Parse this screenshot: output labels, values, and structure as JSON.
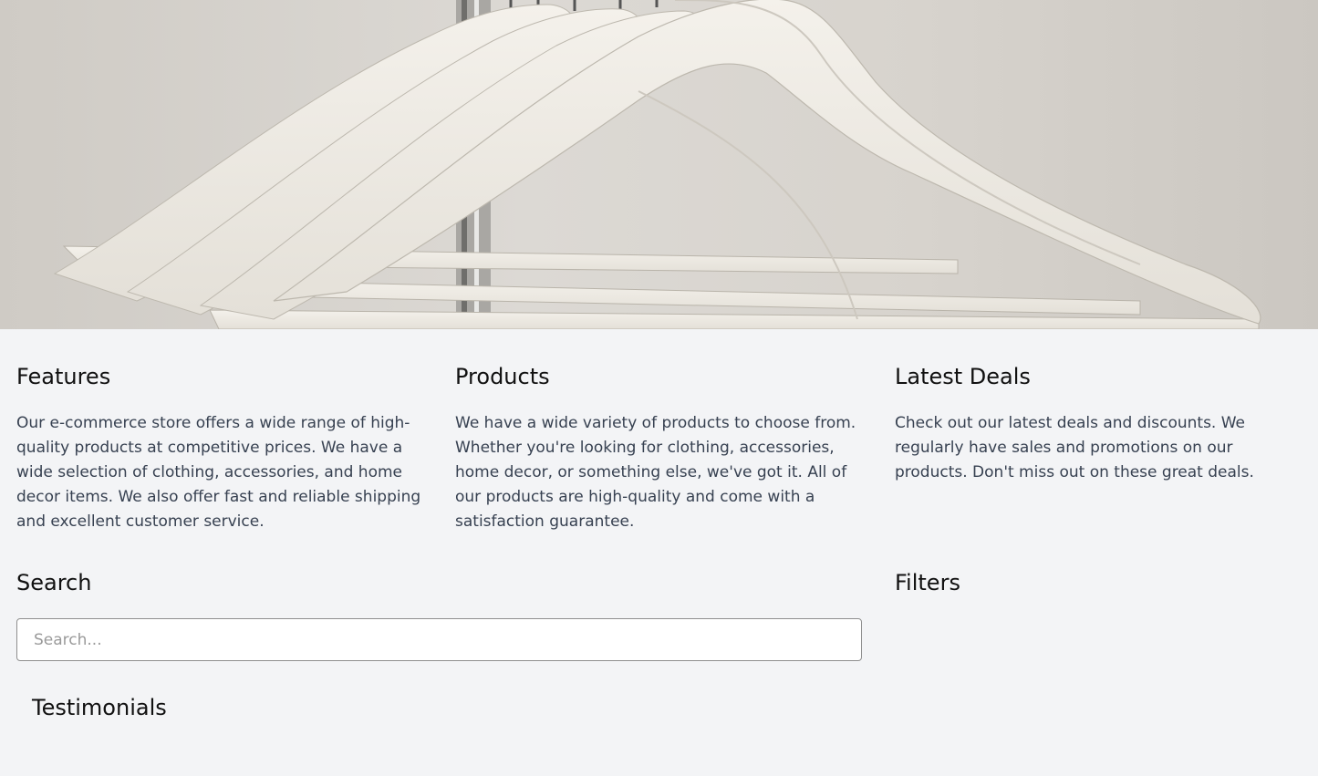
{
  "hero": {
    "image": "clothes-hangers-photo",
    "colors": {
      "background": "#d9d6d1",
      "hanger": "#f2efe9",
      "rail": "#8a8a8a"
    }
  },
  "features": {
    "title": "Features",
    "body": "Our e-commerce store offers a wide range of high-quality products at competitive prices. We have a wide selection of clothing, accessories, and home decor items. We also offer fast and reliable shipping and excellent customer service."
  },
  "products": {
    "title": "Products",
    "body": "We have a wide variety of products to choose from. Whether you're looking for clothing, accessories, home decor, or something else, we've got it. All of our products are high-quality and come with a satisfaction guarantee."
  },
  "deals": {
    "title": "Latest Deals",
    "body": "Check out our latest deals and discounts. We regularly have sales and promotions on our products. Don't miss out on these great deals."
  },
  "search": {
    "title": "Search",
    "placeholder": "Search...",
    "value": ""
  },
  "filters": {
    "title": "Filters"
  },
  "testimonials": {
    "title": "Testimonials"
  },
  "colors": {
    "page_background": "#f3f4f6",
    "heading": "#111111",
    "body_text": "#374151",
    "input_border": "#8f8f8f"
  }
}
